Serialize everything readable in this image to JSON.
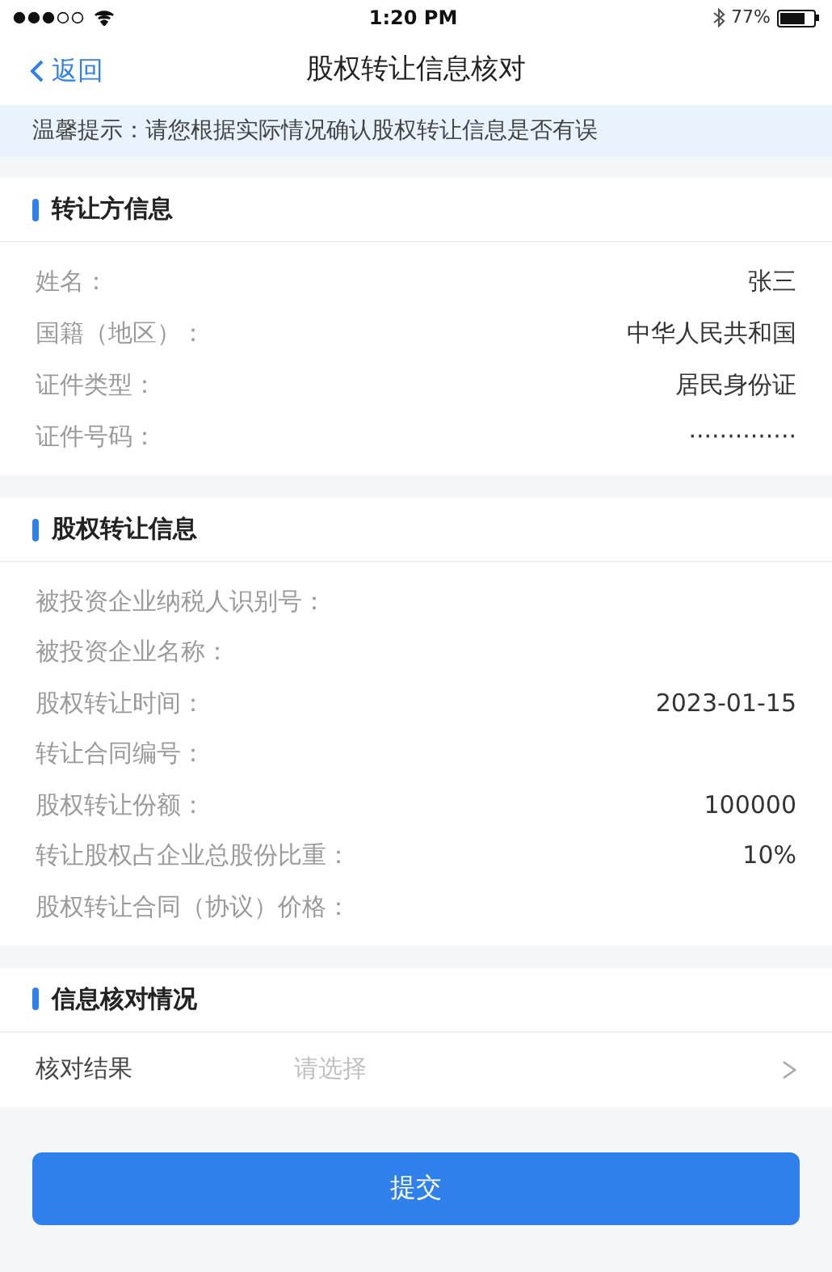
{
  "status_bar": {
    "time": "1:20 PM",
    "battery": "77%"
  },
  "nav": {
    "back": "返回",
    "title": "股权转让信息核对"
  },
  "notice": "温馨提示：请您根据实际情况确认股权转让信息是否有误",
  "sections": [
    {
      "title": "转让方信息",
      "rows": [
        {
          "label": "姓名：",
          "value": "张三"
        },
        {
          "label": "国籍（地区）：",
          "value": "中华人民共和国"
        },
        {
          "label": "证件类型：",
          "value": "居民身份证"
        },
        {
          "label": "证件号码：",
          "value": "··············"
        }
      ]
    },
    {
      "title": "股权转让信息",
      "rows": [
        {
          "label": "被投资企业纳税人识别号："
        },
        {
          "label": "被投资企业名称："
        },
        {
          "label": "股权转让时间：",
          "value": "2023-01-15"
        },
        {
          "label": "转让合同编号："
        },
        {
          "label": "股权转让份额：",
          "value": "100000"
        },
        {
          "label": "转让股权占企业总股份比重：",
          "value": "10%"
        },
        {
          "label": "股权转让合同（协议）价格："
        }
      ]
    },
    {
      "title": "信息核对情况",
      "select": {
        "label": "核对结果",
        "placeholder": "请选择"
      }
    }
  ],
  "submit": "提交"
}
